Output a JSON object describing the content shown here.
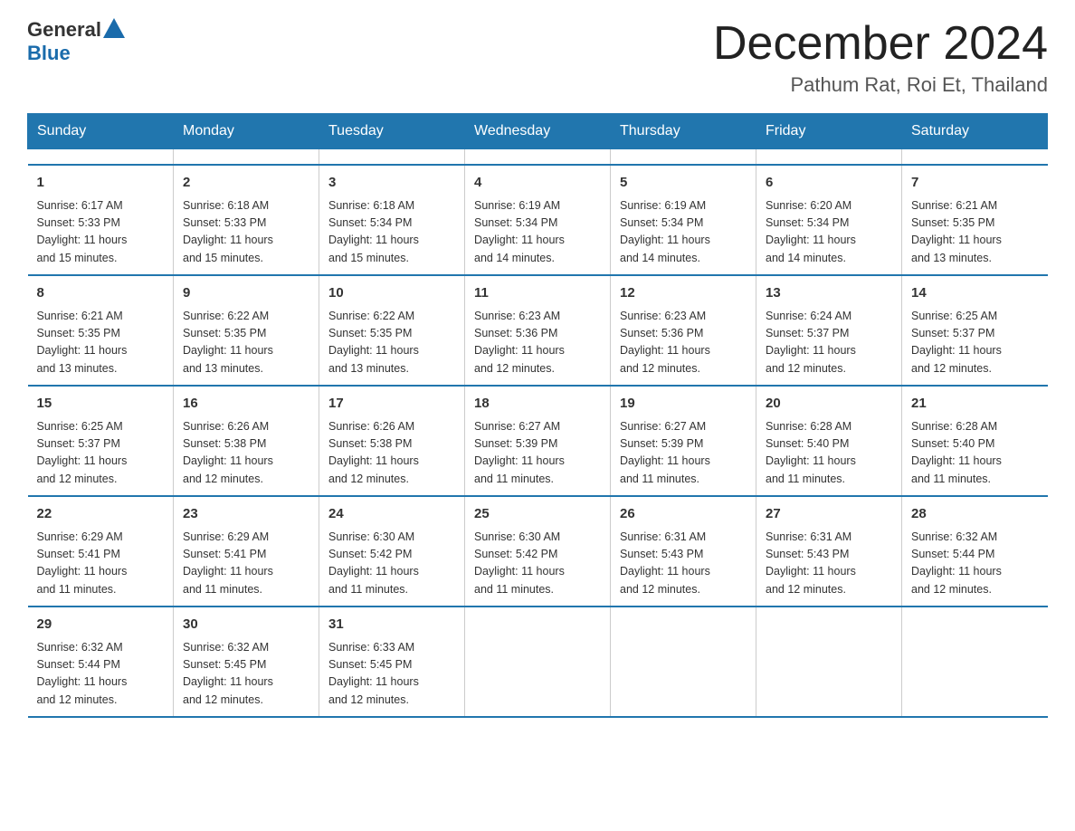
{
  "header": {
    "logo_general": "General",
    "logo_blue": "Blue",
    "title": "December 2024",
    "subtitle": "Pathum Rat, Roi Et, Thailand"
  },
  "calendar": {
    "headers": [
      "Sunday",
      "Monday",
      "Tuesday",
      "Wednesday",
      "Thursday",
      "Friday",
      "Saturday"
    ],
    "weeks": [
      [
        {
          "day": "",
          "info": ""
        },
        {
          "day": "",
          "info": ""
        },
        {
          "day": "",
          "info": ""
        },
        {
          "day": "",
          "info": ""
        },
        {
          "day": "",
          "info": ""
        },
        {
          "day": "",
          "info": ""
        },
        {
          "day": "",
          "info": ""
        }
      ],
      [
        {
          "day": "1",
          "info": "Sunrise: 6:17 AM\nSunset: 5:33 PM\nDaylight: 11 hours\nand 15 minutes."
        },
        {
          "day": "2",
          "info": "Sunrise: 6:18 AM\nSunset: 5:33 PM\nDaylight: 11 hours\nand 15 minutes."
        },
        {
          "day": "3",
          "info": "Sunrise: 6:18 AM\nSunset: 5:34 PM\nDaylight: 11 hours\nand 15 minutes."
        },
        {
          "day": "4",
          "info": "Sunrise: 6:19 AM\nSunset: 5:34 PM\nDaylight: 11 hours\nand 14 minutes."
        },
        {
          "day": "5",
          "info": "Sunrise: 6:19 AM\nSunset: 5:34 PM\nDaylight: 11 hours\nand 14 minutes."
        },
        {
          "day": "6",
          "info": "Sunrise: 6:20 AM\nSunset: 5:34 PM\nDaylight: 11 hours\nand 14 minutes."
        },
        {
          "day": "7",
          "info": "Sunrise: 6:21 AM\nSunset: 5:35 PM\nDaylight: 11 hours\nand 13 minutes."
        }
      ],
      [
        {
          "day": "8",
          "info": "Sunrise: 6:21 AM\nSunset: 5:35 PM\nDaylight: 11 hours\nand 13 minutes."
        },
        {
          "day": "9",
          "info": "Sunrise: 6:22 AM\nSunset: 5:35 PM\nDaylight: 11 hours\nand 13 minutes."
        },
        {
          "day": "10",
          "info": "Sunrise: 6:22 AM\nSunset: 5:35 PM\nDaylight: 11 hours\nand 13 minutes."
        },
        {
          "day": "11",
          "info": "Sunrise: 6:23 AM\nSunset: 5:36 PM\nDaylight: 11 hours\nand 12 minutes."
        },
        {
          "day": "12",
          "info": "Sunrise: 6:23 AM\nSunset: 5:36 PM\nDaylight: 11 hours\nand 12 minutes."
        },
        {
          "day": "13",
          "info": "Sunrise: 6:24 AM\nSunset: 5:37 PM\nDaylight: 11 hours\nand 12 minutes."
        },
        {
          "day": "14",
          "info": "Sunrise: 6:25 AM\nSunset: 5:37 PM\nDaylight: 11 hours\nand 12 minutes."
        }
      ],
      [
        {
          "day": "15",
          "info": "Sunrise: 6:25 AM\nSunset: 5:37 PM\nDaylight: 11 hours\nand 12 minutes."
        },
        {
          "day": "16",
          "info": "Sunrise: 6:26 AM\nSunset: 5:38 PM\nDaylight: 11 hours\nand 12 minutes."
        },
        {
          "day": "17",
          "info": "Sunrise: 6:26 AM\nSunset: 5:38 PM\nDaylight: 11 hours\nand 12 minutes."
        },
        {
          "day": "18",
          "info": "Sunrise: 6:27 AM\nSunset: 5:39 PM\nDaylight: 11 hours\nand 11 minutes."
        },
        {
          "day": "19",
          "info": "Sunrise: 6:27 AM\nSunset: 5:39 PM\nDaylight: 11 hours\nand 11 minutes."
        },
        {
          "day": "20",
          "info": "Sunrise: 6:28 AM\nSunset: 5:40 PM\nDaylight: 11 hours\nand 11 minutes."
        },
        {
          "day": "21",
          "info": "Sunrise: 6:28 AM\nSunset: 5:40 PM\nDaylight: 11 hours\nand 11 minutes."
        }
      ],
      [
        {
          "day": "22",
          "info": "Sunrise: 6:29 AM\nSunset: 5:41 PM\nDaylight: 11 hours\nand 11 minutes."
        },
        {
          "day": "23",
          "info": "Sunrise: 6:29 AM\nSunset: 5:41 PM\nDaylight: 11 hours\nand 11 minutes."
        },
        {
          "day": "24",
          "info": "Sunrise: 6:30 AM\nSunset: 5:42 PM\nDaylight: 11 hours\nand 11 minutes."
        },
        {
          "day": "25",
          "info": "Sunrise: 6:30 AM\nSunset: 5:42 PM\nDaylight: 11 hours\nand 11 minutes."
        },
        {
          "day": "26",
          "info": "Sunrise: 6:31 AM\nSunset: 5:43 PM\nDaylight: 11 hours\nand 12 minutes."
        },
        {
          "day": "27",
          "info": "Sunrise: 6:31 AM\nSunset: 5:43 PM\nDaylight: 11 hours\nand 12 minutes."
        },
        {
          "day": "28",
          "info": "Sunrise: 6:32 AM\nSunset: 5:44 PM\nDaylight: 11 hours\nand 12 minutes."
        }
      ],
      [
        {
          "day": "29",
          "info": "Sunrise: 6:32 AM\nSunset: 5:44 PM\nDaylight: 11 hours\nand 12 minutes."
        },
        {
          "day": "30",
          "info": "Sunrise: 6:32 AM\nSunset: 5:45 PM\nDaylight: 11 hours\nand 12 minutes."
        },
        {
          "day": "31",
          "info": "Sunrise: 6:33 AM\nSunset: 5:45 PM\nDaylight: 11 hours\nand 12 minutes."
        },
        {
          "day": "",
          "info": ""
        },
        {
          "day": "",
          "info": ""
        },
        {
          "day": "",
          "info": ""
        },
        {
          "day": "",
          "info": ""
        }
      ]
    ]
  }
}
